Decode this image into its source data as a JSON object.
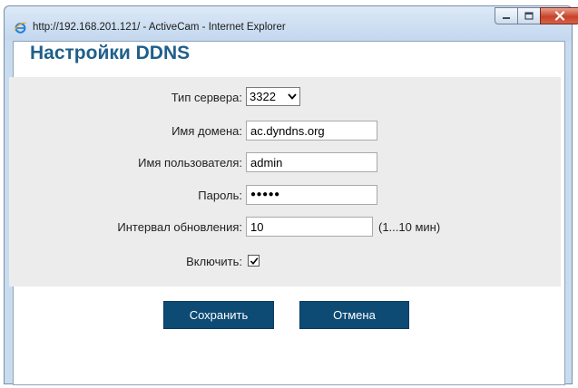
{
  "window": {
    "title": "http://192.168.201.121/ - ActiveCam - Internet Explorer"
  },
  "page": {
    "title": "Настройки DDNS"
  },
  "form": {
    "server_type": {
      "label": "Тип сервера:",
      "value": "3322"
    },
    "domain": {
      "label": "Имя домена:",
      "value": "ac.dyndns.org"
    },
    "username": {
      "label": "Имя пользователя:",
      "value": "admin"
    },
    "password": {
      "label": "Пароль:",
      "value": "●●●●●"
    },
    "interval": {
      "label": "Интервал обновления:",
      "value": "10",
      "hint": "(1...10 мин)"
    },
    "enable": {
      "label": "Включить:",
      "checked": true
    }
  },
  "buttons": {
    "save": "Сохранить",
    "cancel": "Отмена"
  },
  "colors": {
    "accent": "#0d4a74",
    "title": "#1f5f8b",
    "panel": "#ececec"
  },
  "icons": {
    "browser": "ie-icon",
    "minimize": "minimize-icon",
    "maximize": "maximize-icon",
    "close": "close-icon",
    "dropdown": "chevron-down-icon",
    "check": "checkmark-icon"
  }
}
